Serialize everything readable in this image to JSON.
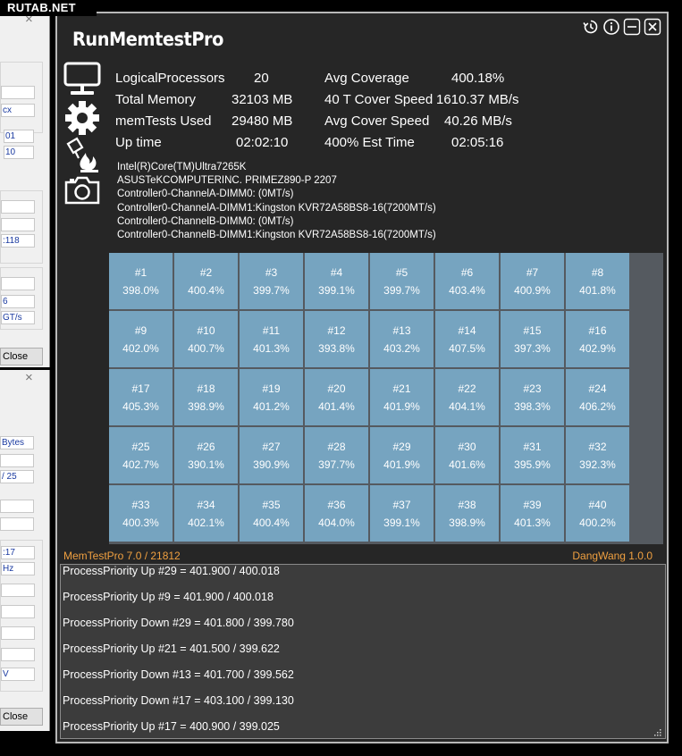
{
  "watermark": "RUTAB.NET",
  "bg_window_1": {
    "close": "×",
    "fields": [
      "cx",
      "01",
      "10",
      ":118",
      "6",
      "GT/s"
    ],
    "close_button": "Close"
  },
  "bg_window_2": {
    "close": "×",
    "fields": [
      "Bytes",
      "/ 25",
      ":17",
      "Hz",
      "V"
    ],
    "close_button": "Close"
  },
  "app": {
    "title": "RunMemtestPro",
    "icons": [
      "history-icon",
      "info-icon",
      "minimize-icon",
      "close-icon"
    ],
    "stats": {
      "logical_processors_label": "LogicalProcessors",
      "logical_processors": "20",
      "total_memory_label": "Total Memory",
      "total_memory": "32103 MB",
      "memtests_used_label": "memTests Used",
      "memtests_used": "29480 MB",
      "up_time_label": "Up time",
      "up_time": "02:02:10",
      "avg_coverage_label": "Avg Coverage",
      "avg_coverage": "400.18%",
      "cover_speed_40t_label": "40 T Cover Speed",
      "cover_speed_40t": "1610.37 MB/s",
      "avg_cover_speed_label": "Avg Cover Speed",
      "avg_cover_speed": "40.26 MB/s",
      "est_time_label": "400% Est Time",
      "est_time": "02:05:16"
    },
    "sysinfo": [
      "Intel(R)Core(TM)Ultra7265K",
      "ASUSTeKCOMPUTERINC. PRIMEZ890-P 2207",
      "Controller0-ChannelA-DIMM0: (0MT/s)",
      "Controller0-ChannelA-DIMM1:Kingston KVR72A58BS8-16(7200MT/s)",
      "Controller0-ChannelB-DIMM0: (0MT/s)",
      "Controller0-ChannelB-DIMM1:Kingston KVR72A58BS8-16(7200MT/s)"
    ],
    "threads": [
      {
        "id": "#1",
        "pct": "398.0%"
      },
      {
        "id": "#2",
        "pct": "400.4%"
      },
      {
        "id": "#3",
        "pct": "399.7%"
      },
      {
        "id": "#4",
        "pct": "399.1%"
      },
      {
        "id": "#5",
        "pct": "399.7%"
      },
      {
        "id": "#6",
        "pct": "403.4%"
      },
      {
        "id": "#7",
        "pct": "400.9%"
      },
      {
        "id": "#8",
        "pct": "401.8%"
      },
      {
        "id": "#9",
        "pct": "402.0%"
      },
      {
        "id": "#10",
        "pct": "400.7%"
      },
      {
        "id": "#11",
        "pct": "401.3%"
      },
      {
        "id": "#12",
        "pct": "393.8%"
      },
      {
        "id": "#13",
        "pct": "403.2%"
      },
      {
        "id": "#14",
        "pct": "407.5%"
      },
      {
        "id": "#15",
        "pct": "397.3%"
      },
      {
        "id": "#16",
        "pct": "402.9%"
      },
      {
        "id": "#17",
        "pct": "405.3%"
      },
      {
        "id": "#18",
        "pct": "398.9%"
      },
      {
        "id": "#19",
        "pct": "401.2%"
      },
      {
        "id": "#20",
        "pct": "401.4%"
      },
      {
        "id": "#21",
        "pct": "401.9%"
      },
      {
        "id": "#22",
        "pct": "404.1%"
      },
      {
        "id": "#23",
        "pct": "398.3%"
      },
      {
        "id": "#24",
        "pct": "406.2%"
      },
      {
        "id": "#25",
        "pct": "402.7%"
      },
      {
        "id": "#26",
        "pct": "390.1%"
      },
      {
        "id": "#27",
        "pct": "390.9%"
      },
      {
        "id": "#28",
        "pct": "397.7%"
      },
      {
        "id": "#29",
        "pct": "401.9%"
      },
      {
        "id": "#30",
        "pct": "401.6%"
      },
      {
        "id": "#31",
        "pct": "395.9%"
      },
      {
        "id": "#32",
        "pct": "392.3%"
      },
      {
        "id": "#33",
        "pct": "400.3%"
      },
      {
        "id": "#34",
        "pct": "402.1%"
      },
      {
        "id": "#35",
        "pct": "400.4%"
      },
      {
        "id": "#36",
        "pct": "404.0%"
      },
      {
        "id": "#37",
        "pct": "399.1%"
      },
      {
        "id": "#38",
        "pct": "398.9%"
      },
      {
        "id": "#39",
        "pct": "401.3%"
      },
      {
        "id": "#40",
        "pct": "400.2%"
      }
    ],
    "footer_left": "MemTestPro 7.0 / 21812",
    "footer_right": "DangWang 1.0.0",
    "log": [
      "ProcessPriority Up #29 = 401.900 / 400.018",
      "ProcessPriority Up #9 = 401.900 / 400.018",
      "ProcessPriority Down #29 = 401.800 / 399.780",
      "ProcessPriority Up #21 = 401.500 / 399.622",
      "ProcessPriority Down #13 = 401.700 / 399.562",
      "ProcessPriority Down #17 = 403.100 / 399.130",
      "ProcessPriority Up #17 = 400.900 / 399.025"
    ],
    "colors": {
      "cell": "#76a4c0",
      "footer": "#f0a040",
      "background": "#262626"
    }
  }
}
